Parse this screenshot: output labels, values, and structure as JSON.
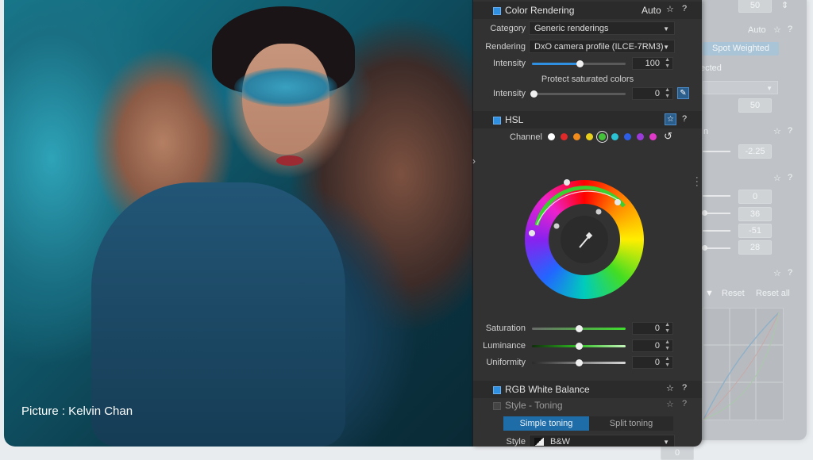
{
  "photo": {
    "caption": "Picture : Kelvin Chan"
  },
  "color_rendering": {
    "title": "Color Rendering",
    "auto_label": "Auto",
    "help": "?",
    "category_label": "Category",
    "category_value": "Generic renderings",
    "rendering_label": "Rendering",
    "rendering_value": "DxO camera profile (ILCE-7RM3)",
    "intensity_label": "Intensity",
    "intensity_value": "100",
    "protect_label": "Protect saturated colors",
    "protect_intensity_label": "Intensity",
    "protect_intensity_value": "0"
  },
  "hsl": {
    "title": "HSL",
    "help": "?",
    "channel_label": "Channel",
    "channels": [
      "white",
      "red",
      "orange",
      "yellow",
      "green",
      "cyan",
      "blue",
      "purple",
      "magenta"
    ],
    "channel_colors": [
      "#ffffff",
      "#e02a2a",
      "#f08b1c",
      "#e8cf1e",
      "#44c23a",
      "#2bc3d4",
      "#2f5ee6",
      "#9a3bd9",
      "#e03ac8"
    ],
    "selected_channel": "green",
    "saturation_label": "Saturation",
    "saturation_value": "0",
    "luminance_label": "Luminance",
    "luminance_value": "0",
    "uniformity_label": "Uniformity",
    "uniformity_value": "0"
  },
  "rgb_wb": {
    "title": "RGB White Balance",
    "help": "?"
  },
  "style_toning": {
    "title": "Style - Toning",
    "help": "?",
    "tab_simple": "Simple toning",
    "tab_split": "Split toning",
    "style_label": "Style",
    "style_value": "B&W"
  },
  "background_panel": {
    "values": [
      "50",
      "50",
      "-2.25",
      "0",
      "36",
      "-51",
      "28",
      "0"
    ],
    "auto_label": "Auto",
    "spot_button": "Spot Weighted",
    "detected_text": "ected",
    "reset_label": "Reset",
    "reset_all_label": "Reset all",
    "help": "?"
  },
  "colors": {
    "accent": "#2f8fe0",
    "panel_bg": "#323232"
  }
}
